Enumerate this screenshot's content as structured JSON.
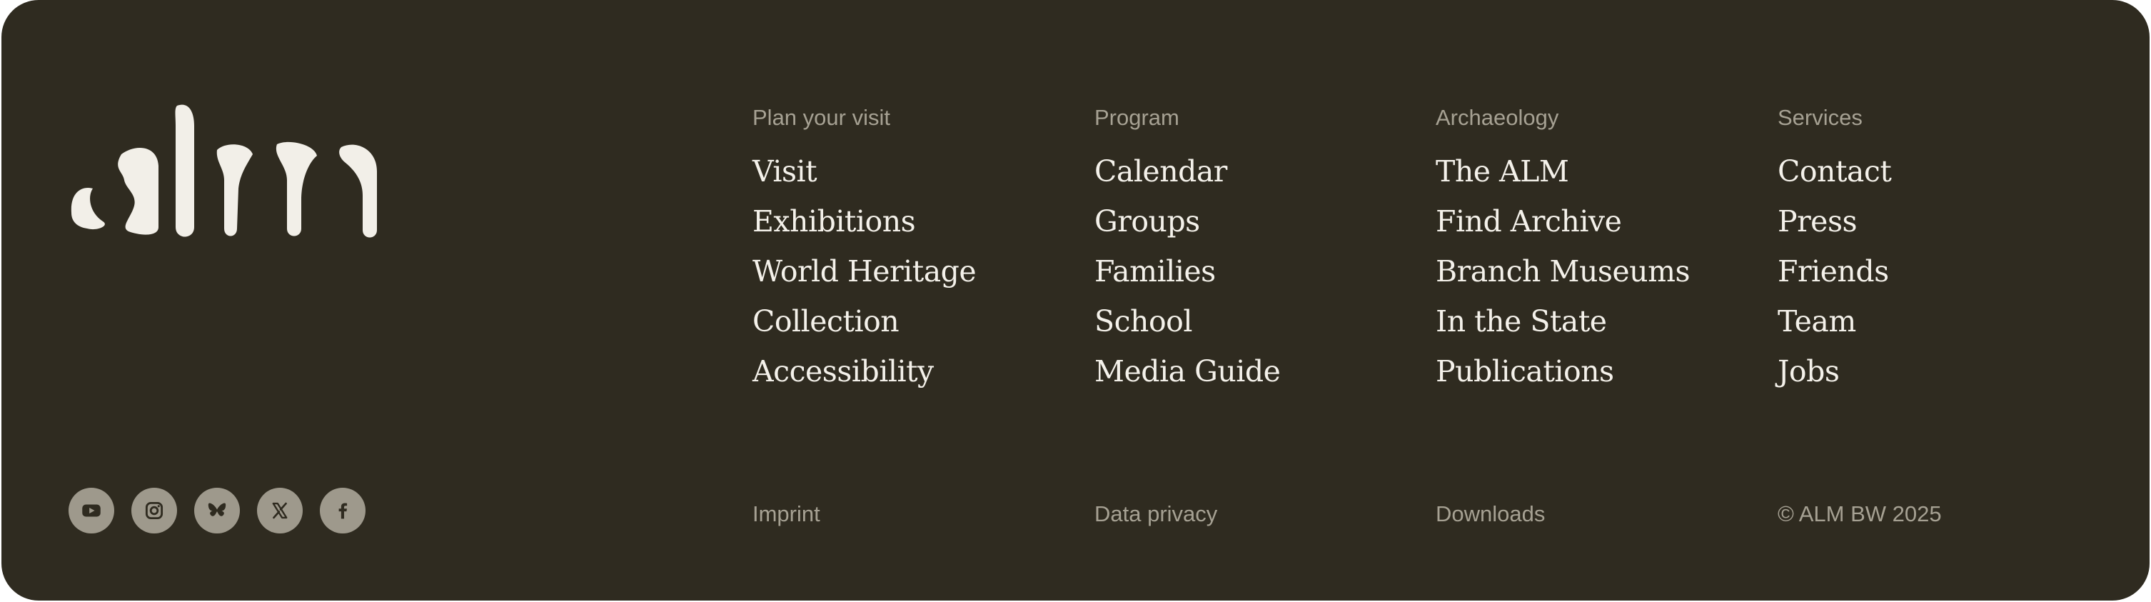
{
  "brand": {
    "logo_text": "alm"
  },
  "columns": [
    {
      "heading": "Plan your visit",
      "links": [
        "Visit",
        "Exhibitions",
        "World Heritage",
        "Collection",
        "Accessibility"
      ]
    },
    {
      "heading": "Program",
      "links": [
        "Calendar",
        "Groups",
        "Families",
        "School",
        "Media Guide"
      ]
    },
    {
      "heading": "Archaeology",
      "links": [
        "The ALM",
        "Find Archive",
        "Branch Museums",
        "In the State",
        "Publications"
      ]
    },
    {
      "heading": "Services",
      "links": [
        "Contact",
        "Press",
        "Friends",
        "Team",
        "Jobs"
      ]
    }
  ],
  "bottom": {
    "imprint": "Imprint",
    "privacy": "Data privacy",
    "downloads": "Downloads",
    "copyright": "© ALM BW 2025"
  },
  "social_icons": [
    "youtube-icon",
    "instagram-icon",
    "bluesky-icon",
    "x-icon",
    "facebook-icon"
  ],
  "colors": {
    "background": "#2f2b20",
    "link": "#f4f1ea",
    "muted": "#a6a193",
    "icon_bg": "#9e998c"
  }
}
